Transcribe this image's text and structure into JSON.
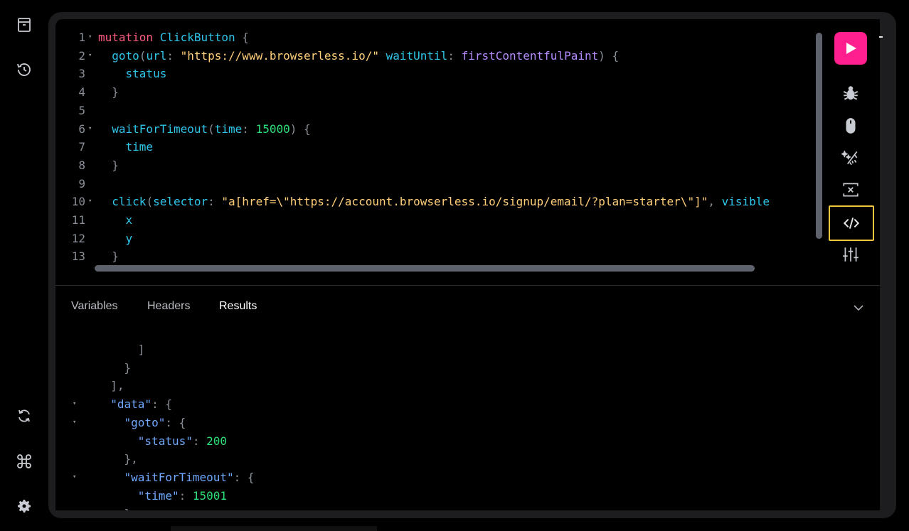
{
  "sidebar": {
    "icons": [
      "archive-icon",
      "history-icon",
      "refresh-icon",
      "command-icon",
      "settings-icon"
    ]
  },
  "editor": {
    "lines": [
      {
        "num": "1",
        "fold": "▾",
        "tokens": [
          {
            "t": "mutation ",
            "c": "kw"
          },
          {
            "t": "ClickButton",
            "c": "fn"
          },
          {
            "t": " {",
            "c": "pn"
          }
        ]
      },
      {
        "num": "2",
        "fold": "▾",
        "tokens": [
          {
            "t": "  goto",
            "c": "fn"
          },
          {
            "t": "(",
            "c": "pn"
          },
          {
            "t": "url",
            "c": "pr"
          },
          {
            "t": ": ",
            "c": "pn"
          },
          {
            "t": "\"https://www.browserless.io/\"",
            "c": "st"
          },
          {
            "t": " ",
            "c": "pn"
          },
          {
            "t": "waitUntil",
            "c": "pr"
          },
          {
            "t": ": ",
            "c": "pn"
          },
          {
            "t": "firstContentfulPaint",
            "c": "en"
          },
          {
            "t": ") {",
            "c": "pn"
          }
        ]
      },
      {
        "num": "3",
        "fold": "",
        "tokens": [
          {
            "t": "    status",
            "c": "fn"
          }
        ]
      },
      {
        "num": "4",
        "fold": "",
        "tokens": [
          {
            "t": "  }",
            "c": "pn"
          }
        ]
      },
      {
        "num": "5",
        "fold": "",
        "tokens": []
      },
      {
        "num": "6",
        "fold": "▾",
        "tokens": [
          {
            "t": "  waitForTimeout",
            "c": "fn"
          },
          {
            "t": "(",
            "c": "pn"
          },
          {
            "t": "time",
            "c": "pr"
          },
          {
            "t": ": ",
            "c": "pn"
          },
          {
            "t": "15000",
            "c": "nm"
          },
          {
            "t": ") {",
            "c": "pn"
          }
        ]
      },
      {
        "num": "7",
        "fold": "",
        "tokens": [
          {
            "t": "    time",
            "c": "fn"
          }
        ]
      },
      {
        "num": "8",
        "fold": "",
        "tokens": [
          {
            "t": "  }",
            "c": "pn"
          }
        ]
      },
      {
        "num": "9",
        "fold": "",
        "tokens": []
      },
      {
        "num": "10",
        "fold": "▾",
        "tokens": [
          {
            "t": "  click",
            "c": "fn"
          },
          {
            "t": "(",
            "c": "pn"
          },
          {
            "t": "selector",
            "c": "pr"
          },
          {
            "t": ": ",
            "c": "pn"
          },
          {
            "t": "\"a[href=\\\"https://account.browserless.io/signup/email/?plan=starter\\\"]\"",
            "c": "st"
          },
          {
            "t": ", ",
            "c": "pn"
          },
          {
            "t": "visible",
            "c": "pr"
          }
        ]
      },
      {
        "num": "11",
        "fold": "",
        "tokens": [
          {
            "t": "    x",
            "c": "fn"
          }
        ]
      },
      {
        "num": "12",
        "fold": "",
        "tokens": [
          {
            "t": "    y",
            "c": "fn"
          }
        ]
      },
      {
        "num": "13",
        "fold": "",
        "tokens": [
          {
            "t": "  }",
            "c": "pn"
          }
        ]
      }
    ]
  },
  "toolbar": {
    "icons": [
      "play-icon",
      "bug-icon",
      "mouse-icon",
      "magic-wand-icon",
      "screenshot-icon",
      "code-icon",
      "sliders-icon"
    ]
  },
  "results": {
    "tabs": [
      "Variables",
      "Headers",
      "Results"
    ],
    "active_tab": "Results",
    "lines": [
      {
        "fold": "",
        "tokens": [
          {
            "t": "      ]",
            "c": "pn"
          }
        ]
      },
      {
        "fold": "",
        "tokens": [
          {
            "t": "    }",
            "c": "pn"
          }
        ]
      },
      {
        "fold": "",
        "tokens": [
          {
            "t": "  ],",
            "c": "pn"
          }
        ]
      },
      {
        "fold": "▾",
        "tokens": [
          {
            "t": "  ",
            "c": "pn"
          },
          {
            "t": "\"data\"",
            "c": "key"
          },
          {
            "t": ": {",
            "c": "pn"
          }
        ]
      },
      {
        "fold": "▾",
        "tokens": [
          {
            "t": "    ",
            "c": "pn"
          },
          {
            "t": "\"goto\"",
            "c": "key"
          },
          {
            "t": ": {",
            "c": "pn"
          }
        ]
      },
      {
        "fold": "",
        "tokens": [
          {
            "t": "      ",
            "c": "pn"
          },
          {
            "t": "\"status\"",
            "c": "key"
          },
          {
            "t": ": ",
            "c": "pn"
          },
          {
            "t": "200",
            "c": "nm"
          }
        ]
      },
      {
        "fold": "",
        "tokens": [
          {
            "t": "    },",
            "c": "pn"
          }
        ]
      },
      {
        "fold": "▾",
        "tokens": [
          {
            "t": "    ",
            "c": "pn"
          },
          {
            "t": "\"waitForTimeout\"",
            "c": "key"
          },
          {
            "t": ": {",
            "c": "pn"
          }
        ]
      },
      {
        "fold": "",
        "tokens": [
          {
            "t": "      ",
            "c": "pn"
          },
          {
            "t": "\"time\"",
            "c": "key"
          },
          {
            "t": ": ",
            "c": "pn"
          },
          {
            "t": "15001",
            "c": "nm"
          }
        ]
      },
      {
        "fold": "",
        "tokens": [
          {
            "t": "    },",
            "c": "pn"
          }
        ]
      }
    ]
  },
  "colors": {
    "accent": "#ff1f8e",
    "highlight": "#f2c53d",
    "keyword": "#ff5a80",
    "field": "#2fc6ea",
    "string": "#ffcf7a",
    "number": "#2ee07a",
    "enum": "#b58cff"
  }
}
